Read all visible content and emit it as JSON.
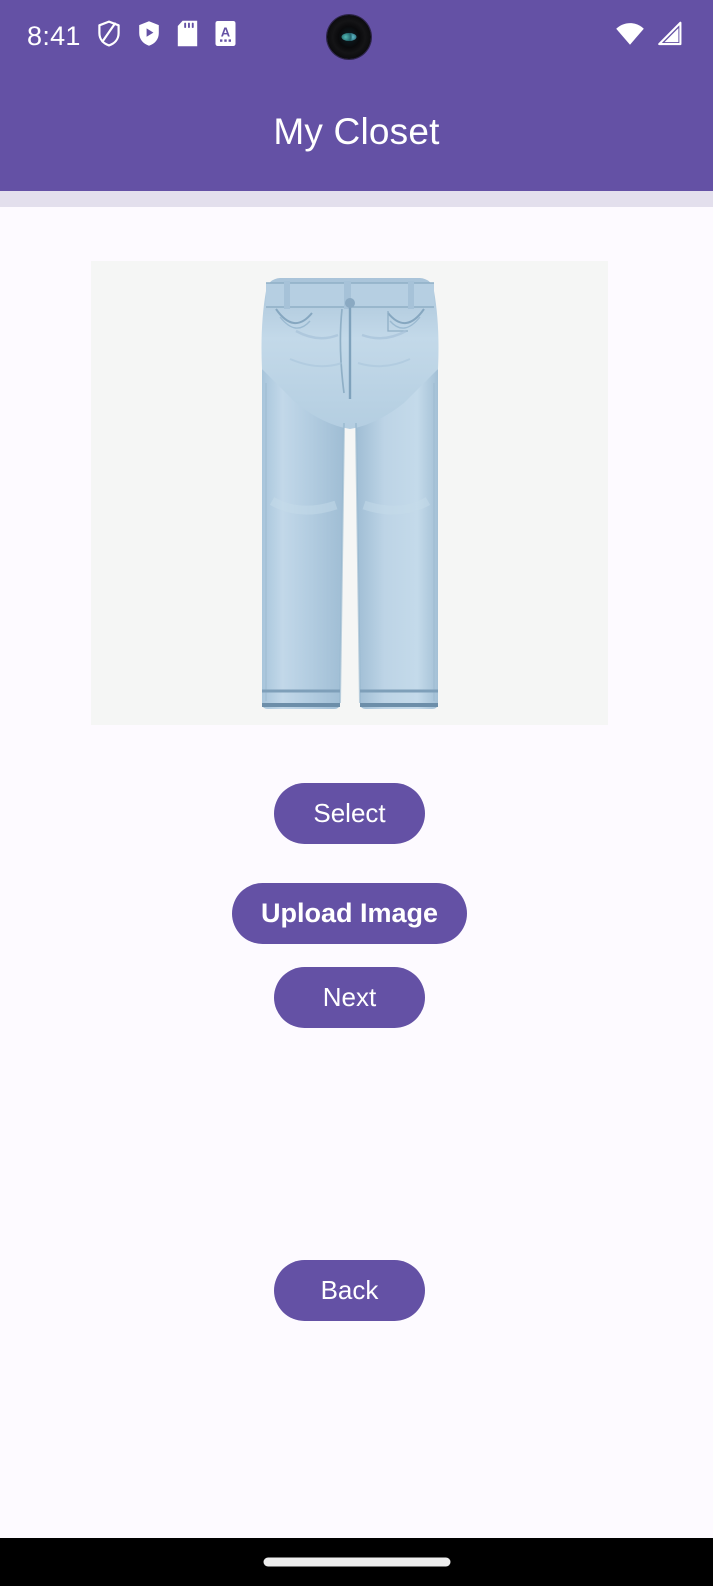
{
  "status_bar": {
    "time": "8:41",
    "background_color": "#6451A5",
    "foreground_color": "#FFFFFF",
    "left_icons": [
      {
        "name": "shield-outline-icon",
        "label": "VPN protection"
      },
      {
        "name": "shield-play-icon",
        "label": "Secure media"
      },
      {
        "name": "sd-card-icon",
        "label": "SD card"
      },
      {
        "name": "document-a-icon",
        "label": "Input method"
      }
    ],
    "right_icons": [
      {
        "name": "wifi-icon",
        "label": "Wi-Fi"
      },
      {
        "name": "cellular-signal-icon",
        "label": "Cellular signal"
      }
    ],
    "camera": {
      "name": "front-camera-punch-hole"
    }
  },
  "app_bar": {
    "title": "My Closet",
    "background_color": "#6451A5",
    "title_color": "#FFFFFF",
    "underline_color": "#E3DFED"
  },
  "content": {
    "background_color": "#FDFAFF",
    "image_preview": {
      "name": "selected-garment-image",
      "alt": "Light wash blue straight-leg jeans",
      "background_color": "#F5F6F5",
      "denim_light": "#BFD6E8",
      "denim_mid": "#A9C6DC",
      "denim_dark": "#8FB2CC"
    },
    "buttons": [
      {
        "id": "select",
        "label": "Select"
      },
      {
        "id": "upload",
        "label": "Upload Image"
      },
      {
        "id": "next",
        "label": "Next"
      },
      {
        "id": "back",
        "label": "Back"
      }
    ],
    "button_color": "#6451A5",
    "button_text_color": "#FFFFFF"
  },
  "nav_bar": {
    "background_color": "#000000",
    "gesture_pill_color": "#EDEDED",
    "gesture_pill_label": "Home gesture handle"
  }
}
